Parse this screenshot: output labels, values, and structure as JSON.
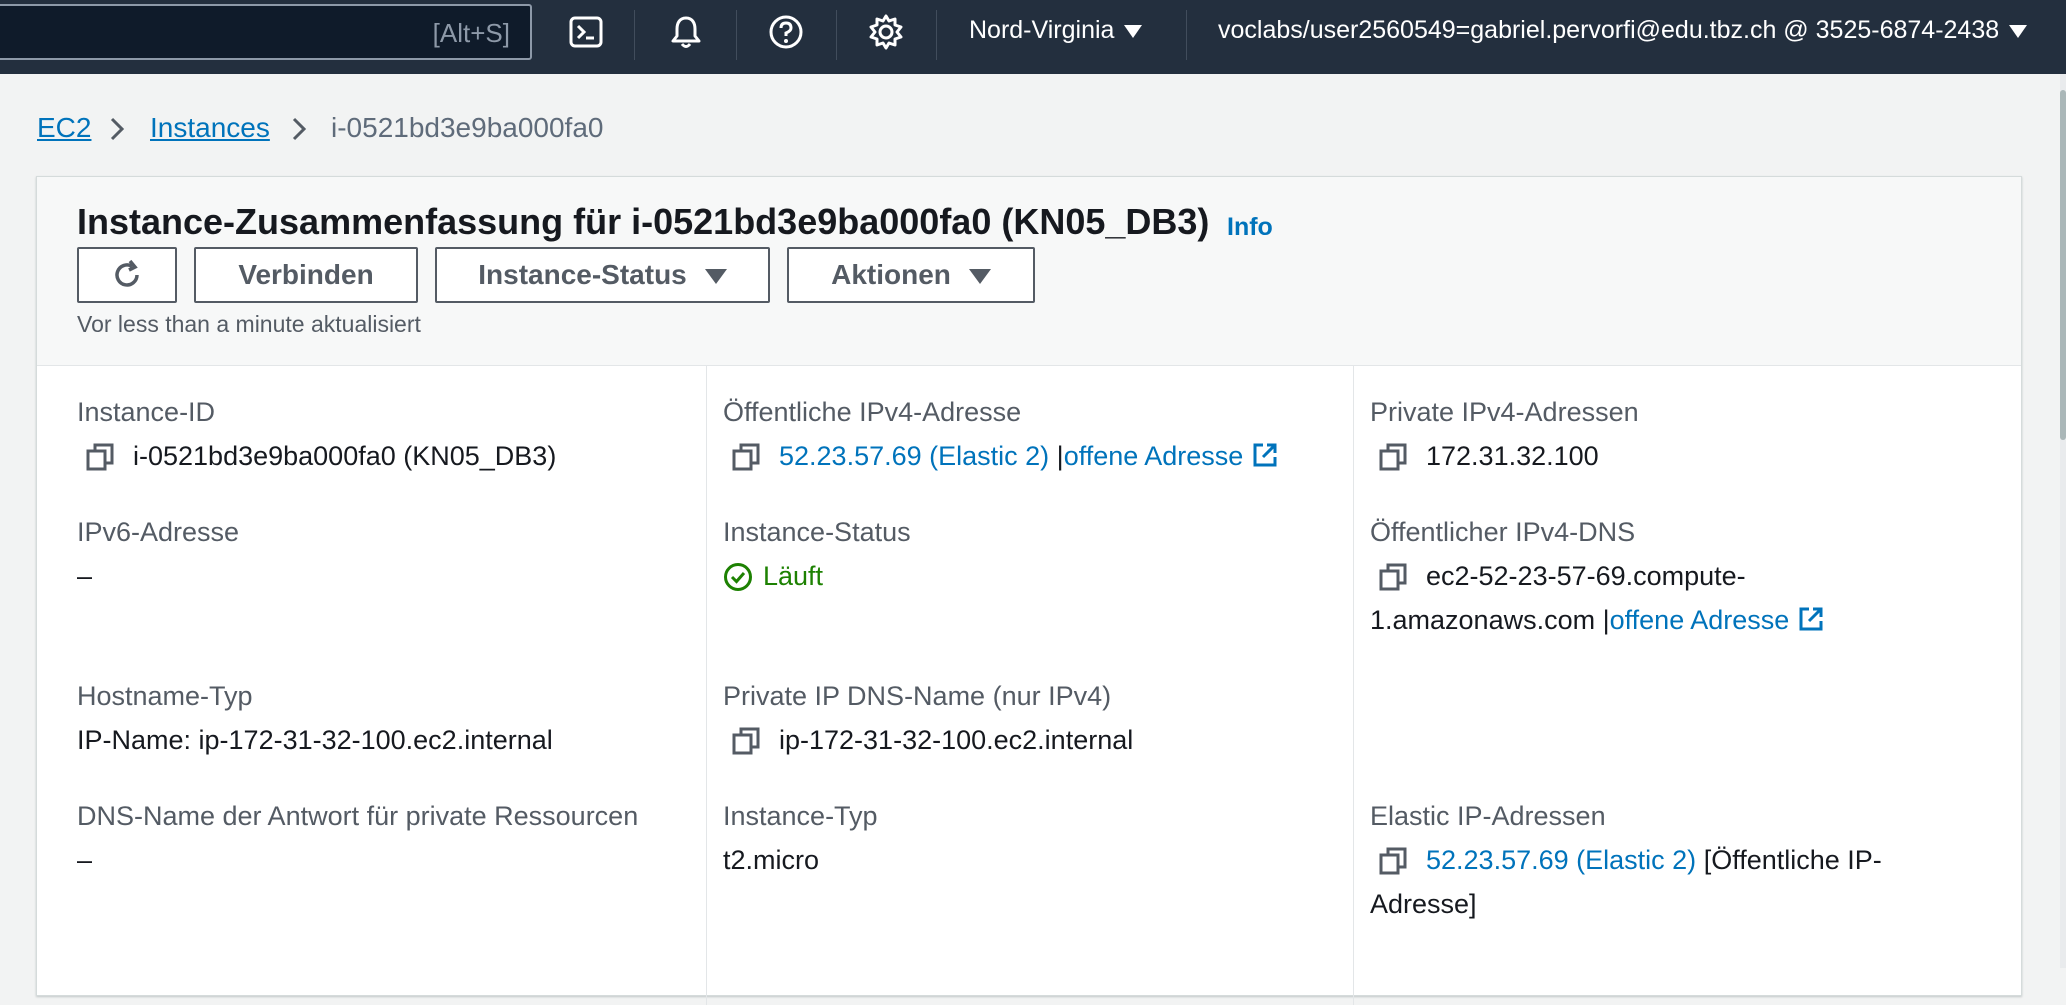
{
  "topnav": {
    "search_shortcut": "[Alt+S]",
    "region": "Nord-Virginia",
    "account": "voclabs/user2560549=gabriel.pervorfi@edu.tbz.ch @ 3525-6874-2438",
    "icons": [
      "cloudshell-icon",
      "bell-icon",
      "help-icon",
      "gear-icon"
    ]
  },
  "breadcrumb": {
    "root": "EC2",
    "section": "Instances",
    "current": "i-0521bd3e9ba000fa0"
  },
  "summary": {
    "title": "Instance-Zusammenfassung für i-0521bd3e9ba000fa0 (KN05_DB3)",
    "info": "Info",
    "buttons": {
      "connect": "Verbinden",
      "instance_state": "Instance-Status",
      "actions": "Aktionen"
    },
    "updated": "Vor less than a minute aktualisiert"
  },
  "details": {
    "instance_id": {
      "label": "Instance-ID",
      "value": "i-0521bd3e9ba000fa0 (KN05_DB3)"
    },
    "public_ipv4": {
      "label": "Öffentliche IPv4-Adresse",
      "value": "52.23.57.69 (Elastic 2)",
      "open": "offene Adresse"
    },
    "private_ipv4": {
      "label": "Private IPv4-Adressen",
      "value": "172.31.32.100"
    },
    "ipv6": {
      "label": "IPv6-Adresse",
      "value": "–"
    },
    "instance_state": {
      "label": "Instance-Status",
      "value": "Läuft"
    },
    "public_dns": {
      "label": "Öffentlicher IPv4-DNS",
      "value_line1": "ec2-52-23-57-69.compute-",
      "value_line2": "1.amazonaws.com",
      "open": "offene Adresse"
    },
    "hostname_type": {
      "label": "Hostname-Typ",
      "value": "IP-Name: ip-172-31-32-100.ec2.internal"
    },
    "private_dns": {
      "label": "Private IP DNS-Name (nur IPv4)",
      "value": "ip-172-31-32-100.ec2.internal"
    },
    "dns_answer": {
      "label": "DNS-Name der Antwort für private Ressourcen",
      "value": "–"
    },
    "instance_type": {
      "label": "Instance-Typ",
      "value": "t2.micro"
    },
    "elastic_ips": {
      "label": "Elastic IP-Adressen",
      "value": "52.23.57.69 (Elastic 2)",
      "suffix_line1": "[Öffentliche IP-",
      "suffix_line2": "Adresse]"
    }
  },
  "colors": {
    "nav_bg": "#232f3e",
    "link": "#0073bb",
    "success": "#1d8102"
  }
}
